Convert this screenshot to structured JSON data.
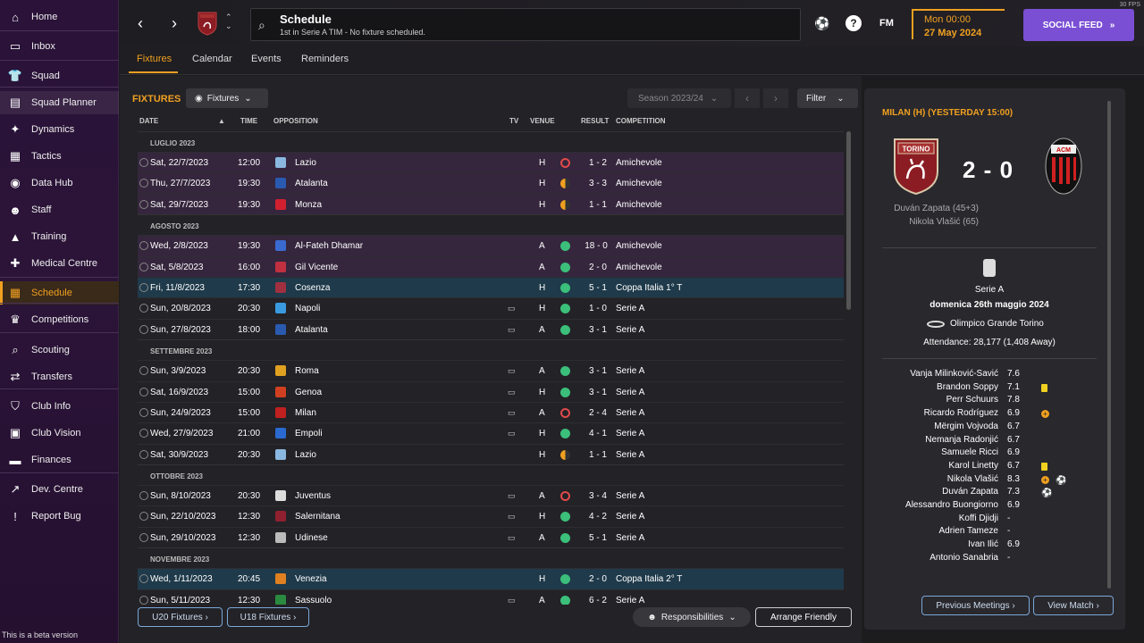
{
  "sidebar": {
    "items": [
      {
        "label": "Home",
        "icon": "home-icon"
      },
      {
        "label": "Inbox",
        "icon": "inbox-icon"
      },
      {
        "label": "Squad",
        "icon": "shirt-icon"
      },
      {
        "label": "Squad Planner",
        "icon": "clipboard-icon"
      },
      {
        "label": "Dynamics",
        "icon": "dynamics-icon"
      },
      {
        "label": "Tactics",
        "icon": "tactics-icon"
      },
      {
        "label": "Data Hub",
        "icon": "data-hub-icon"
      },
      {
        "label": "Staff",
        "icon": "staff-icon"
      },
      {
        "label": "Training",
        "icon": "training-icon"
      },
      {
        "label": "Medical Centre",
        "icon": "medical-icon"
      },
      {
        "label": "Schedule",
        "icon": "calendar-icon"
      },
      {
        "label": "Competitions",
        "icon": "trophy-icon"
      },
      {
        "label": "Scouting",
        "icon": "scouting-icon"
      },
      {
        "label": "Transfers",
        "icon": "transfers-icon"
      },
      {
        "label": "Club Info",
        "icon": "shield-icon"
      },
      {
        "label": "Club Vision",
        "icon": "briefcase-icon"
      },
      {
        "label": "Finances",
        "icon": "money-icon"
      },
      {
        "label": "Dev. Centre",
        "icon": "dev-centre-icon"
      },
      {
        "label": "Report Bug",
        "icon": "alert-icon"
      }
    ],
    "beta_note": "This is a beta version"
  },
  "header": {
    "title": "Schedule",
    "subtitle": "1st in Serie A TIM - No fixture scheduled.",
    "fm_label": "FM",
    "date_time": "Mon 00:00",
    "date_day": "27 May 2024",
    "social_feed": "SOCIAL FEED",
    "fps": "30 FPS"
  },
  "tabs": [
    "Fixtures",
    "Calendar",
    "Events",
    "Reminders"
  ],
  "fixtures": {
    "title": "FIXTURES",
    "view_dropdown": "Fixtures",
    "season": "Season 2023/24",
    "filter": "Filter",
    "columns": {
      "date": "DATE",
      "time": "TIME",
      "opposition": "OPPOSITION",
      "tv": "TV",
      "venue": "VENUE",
      "result": "RESULT",
      "competition": "COMPETITION"
    },
    "groups": [
      {
        "month": "LUGLIO 2023",
        "rows": [
          {
            "date": "Sat, 22/7/2023",
            "time": "12:00",
            "opp": "Lazio",
            "tv": "",
            "venue": "H",
            "outcome": "loss",
            "result": "1 - 2",
            "comp": "Amichevole",
            "type": "friendly",
            "crest": "#8ab8e0"
          },
          {
            "date": "Thu, 27/7/2023",
            "time": "19:30",
            "opp": "Atalanta",
            "tv": "",
            "venue": "H",
            "outcome": "draw",
            "result": "3 - 3",
            "comp": "Amichevole",
            "type": "friendly",
            "crest": "#2a5ab0"
          },
          {
            "date": "Sat, 29/7/2023",
            "time": "19:30",
            "opp": "Monza",
            "tv": "",
            "venue": "H",
            "outcome": "draw",
            "result": "1 - 1",
            "comp": "Amichevole",
            "type": "friendly",
            "crest": "#d02030"
          }
        ]
      },
      {
        "month": "AGOSTO 2023",
        "rows": [
          {
            "date": "Wed, 2/8/2023",
            "time": "19:30",
            "opp": "Al-Fateh Dhamar",
            "tv": "",
            "venue": "A",
            "outcome": "win",
            "result": "18 - 0",
            "comp": "Amichevole",
            "type": "friendly",
            "crest": "#3a6ad0"
          },
          {
            "date": "Sat, 5/8/2023",
            "time": "16:00",
            "opp": "Gil Vicente",
            "tv": "",
            "venue": "A",
            "outcome": "win",
            "result": "2 - 0",
            "comp": "Amichevole",
            "type": "friendly",
            "crest": "#c03040"
          },
          {
            "date": "Fri, 11/8/2023",
            "time": "17:30",
            "opp": "Cosenza",
            "tv": "",
            "venue": "H",
            "outcome": "win",
            "result": "5 - 1",
            "comp": "Coppa Italia 1° T",
            "type": "cup",
            "crest": "#a03040"
          },
          {
            "date": "Sun, 20/8/2023",
            "time": "20:30",
            "opp": "Napoli",
            "tv": "tv",
            "venue": "H",
            "outcome": "win",
            "result": "1 - 0",
            "comp": "Serie A",
            "type": "league",
            "crest": "#3a9ae0"
          },
          {
            "date": "Sun, 27/8/2023",
            "time": "18:00",
            "opp": "Atalanta",
            "tv": "tv",
            "venue": "A",
            "outcome": "win",
            "result": "3 - 1",
            "comp": "Serie A",
            "type": "league",
            "crest": "#2a5ab0"
          }
        ]
      },
      {
        "month": "SETTEMBRE 2023",
        "rows": [
          {
            "date": "Sun, 3/9/2023",
            "time": "20:30",
            "opp": "Roma",
            "tv": "tv",
            "venue": "A",
            "outcome": "win",
            "result": "3 - 1",
            "comp": "Serie A",
            "type": "league",
            "crest": "#e0a020"
          },
          {
            "date": "Sat, 16/9/2023",
            "time": "15:00",
            "opp": "Genoa",
            "tv": "tv",
            "venue": "H",
            "outcome": "win",
            "result": "3 - 1",
            "comp": "Serie A",
            "type": "league",
            "crest": "#d04020"
          },
          {
            "date": "Sun, 24/9/2023",
            "time": "15:00",
            "opp": "Milan",
            "tv": "tv",
            "venue": "A",
            "outcome": "loss",
            "result": "2 - 4",
            "comp": "Serie A",
            "type": "league",
            "crest": "#c02020"
          },
          {
            "date": "Wed, 27/9/2023",
            "time": "21:00",
            "opp": "Empoli",
            "tv": "tv",
            "venue": "H",
            "outcome": "win",
            "result": "4 - 1",
            "comp": "Serie A",
            "type": "league",
            "crest": "#2a6ad0"
          },
          {
            "date": "Sat, 30/9/2023",
            "time": "20:30",
            "opp": "Lazio",
            "tv": "",
            "venue": "H",
            "outcome": "draw",
            "result": "1 - 1",
            "comp": "Serie A",
            "type": "league",
            "crest": "#8ab8e0"
          }
        ]
      },
      {
        "month": "OTTOBRE 2023",
        "rows": [
          {
            "date": "Sun, 8/10/2023",
            "time": "20:30",
            "opp": "Juventus",
            "tv": "tv",
            "venue": "A",
            "outcome": "loss",
            "result": "3 - 4",
            "comp": "Serie A",
            "type": "league",
            "crest": "#dddddd"
          },
          {
            "date": "Sun, 22/10/2023",
            "time": "12:30",
            "opp": "Salernitana",
            "tv": "tv",
            "venue": "H",
            "outcome": "win",
            "result": "4 - 2",
            "comp": "Serie A",
            "type": "league",
            "crest": "#902030"
          },
          {
            "date": "Sun, 29/10/2023",
            "time": "12:30",
            "opp": "Udinese",
            "tv": "tv",
            "venue": "A",
            "outcome": "win",
            "result": "5 - 1",
            "comp": "Serie A",
            "type": "league",
            "crest": "#bbbbbb"
          }
        ]
      },
      {
        "month": "NOVEMBRE 2023",
        "rows": [
          {
            "date": "Wed, 1/11/2023",
            "time": "20:45",
            "opp": "Venezia",
            "tv": "",
            "venue": "H",
            "outcome": "win",
            "result": "2 - 0",
            "comp": "Coppa Italia 2° T",
            "type": "cup",
            "crest": "#e08020"
          },
          {
            "date": "Sun, 5/11/2023",
            "time": "12:30",
            "opp": "Sassuolo",
            "tv": "tv",
            "venue": "A",
            "outcome": "win",
            "result": "6 - 2",
            "comp": "Serie A",
            "type": "league",
            "crest": "#2a8a40"
          }
        ]
      }
    ],
    "u20": "U20 Fixtures ›",
    "u18": "U18 Fixtures ›",
    "responsibilities": "Responsibilities",
    "arrange": "Arrange Friendly"
  },
  "match": {
    "title": "MILAN (H) (YESTERDAY 15:00)",
    "home_crest_text": "TORINO",
    "away_crest_text": "ACM",
    "score": "2 - 0",
    "scorers": [
      "Duván Zapata (45+3)",
      "Nikola Vlašić (65)"
    ],
    "competition": "Serie A",
    "date": "domenica 26th maggio 2024",
    "venue": "Olimpico Grande Torino",
    "attendance": "Attendance: 28,177 (1,408 Away)",
    "players": [
      {
        "name": "Vanja Milinković-Savić",
        "rating": "7.6",
        "badges": []
      },
      {
        "name": "Brandon Soppy",
        "rating": "7.1",
        "badges": [
          "yellow"
        ]
      },
      {
        "name": "Perr Schuurs",
        "rating": "7.8",
        "badges": []
      },
      {
        "name": "Ricardo Rodríguez",
        "rating": "6.9",
        "badges": [
          "assist"
        ]
      },
      {
        "name": "Mërgim Vojvoda",
        "rating": "6.7",
        "badges": []
      },
      {
        "name": "Nemanja Radonjić",
        "rating": "6.7",
        "badges": []
      },
      {
        "name": "Samuele Ricci",
        "rating": "6.9",
        "badges": []
      },
      {
        "name": "Karol Linetty",
        "rating": "6.7",
        "badges": [
          "yellow"
        ]
      },
      {
        "name": "Nikola Vlašić",
        "rating": "8.3",
        "badges": [
          "assist",
          "goal"
        ]
      },
      {
        "name": "Duván Zapata",
        "rating": "7.3",
        "badges": [
          "goal"
        ]
      },
      {
        "name": "Alessandro Buongiorno",
        "rating": "6.9",
        "badges": []
      },
      {
        "name": "Koffi Djidji",
        "rating": "-",
        "badges": []
      },
      {
        "name": "Adrien Tameze",
        "rating": "-",
        "badges": []
      },
      {
        "name": "Ivan Ilić",
        "rating": "6.9",
        "badges": []
      },
      {
        "name": "Antonio Sanabria",
        "rating": "-",
        "badges": []
      }
    ],
    "previous_meetings": "Previous Meetings ›",
    "view_match": "View Match ›"
  },
  "colors": {
    "accent": "#f0a020",
    "win": "#3bbf7a",
    "loss": "#e04a4a",
    "social": "#7a4fd4",
    "link": "#7aa8d8"
  }
}
